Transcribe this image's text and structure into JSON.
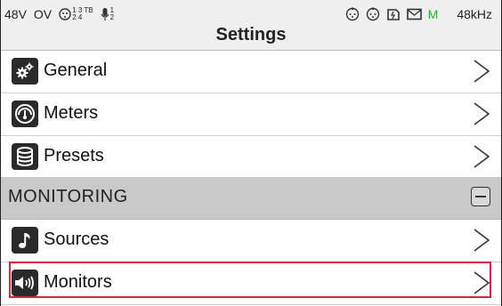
{
  "statusbar": {
    "phantom": "48V",
    "overvolt": "OV",
    "group1_top": "1 3 TB",
    "group1_bottom": "2 4",
    "mic_top": "1",
    "mic_bottom": "2",
    "meter_m": "M",
    "sample_rate": "48kHz",
    "title": "Settings"
  },
  "menu": {
    "general": "General",
    "meters": "Meters",
    "presets": "Presets",
    "section_monitoring": "MONITORING",
    "sources": "Sources",
    "monitors": "Monitors"
  },
  "colors": {
    "highlight": "#d7263d",
    "m_indicator": "#27b33a",
    "section_bg": "#c9c9c9"
  },
  "icons": {
    "general": "gears-icon",
    "meters": "gauge-icon",
    "presets": "database-icon",
    "sources": "music-note-icon",
    "monitors": "speaker-icon"
  }
}
